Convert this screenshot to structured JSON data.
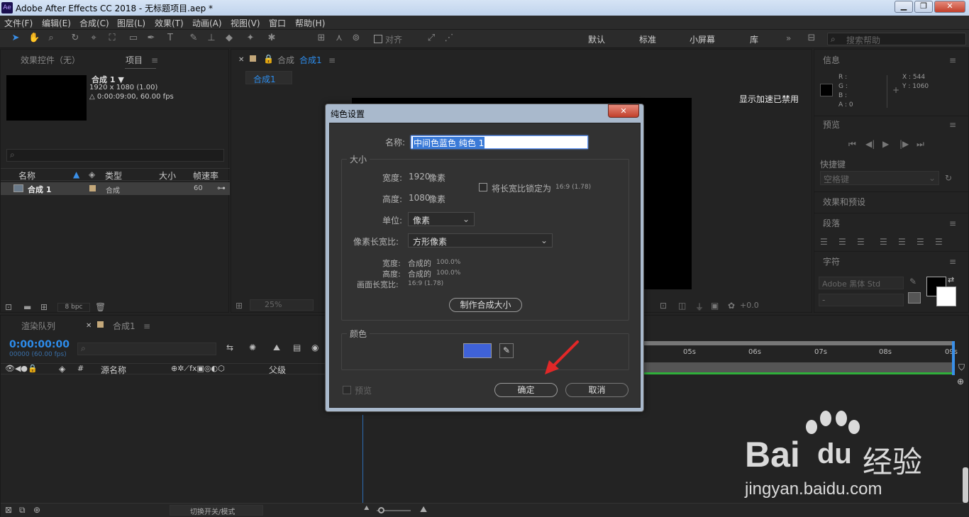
{
  "window": {
    "title": "Adobe After Effects CC 2018 - 无标题项目.aep *",
    "app_badge": "Ae",
    "min": "▁",
    "max": "❐",
    "close": "✕"
  },
  "menu": [
    "文件(F)",
    "编辑(E)",
    "合成(C)",
    "图层(L)",
    "效果(T)",
    "动画(A)",
    "视图(V)",
    "窗口",
    "帮助(H)"
  ],
  "toolbar": {
    "align_label": "对齐",
    "workspaces": [
      "默认",
      "标准",
      "小屏幕",
      "库"
    ],
    "more": "»",
    "search_placeholder": "搜索帮助"
  },
  "project_panel": {
    "tab_effects": "效果控件（无）",
    "tab_project": "项目",
    "comp_name": "合成 1 ▼",
    "comp_res": "1920 x 1080 (1.00)",
    "comp_dur": "△ 0:00:09:00, 60.00 fps",
    "columns": [
      "名称",
      "类型",
      "大小",
      "帧速率"
    ],
    "row": {
      "name": "合成 1",
      "type": "合成",
      "fps": "60"
    },
    "bpc": "8 bpc"
  },
  "comp_panel": {
    "tab_label": "合成",
    "tab_name": "合成1",
    "subtab": "合成1",
    "gpu_notice": "显示加速已禁用",
    "zoom": "25%",
    "exposure": "+0.0"
  },
  "right_panels": {
    "info": "信息",
    "info_r": "R :",
    "info_g": "G :",
    "info_b": "B :",
    "info_a": "A : 0",
    "info_x": "X : 544",
    "info_y": "Y : 1060",
    "preview": "预览",
    "shortcut": "快捷键",
    "shortcut_value": "空格键",
    "effects": "效果和预设",
    "paragraph": "段落",
    "character": "字符",
    "font": "Adobe 黑体 Std",
    "font_style": "-"
  },
  "timeline": {
    "tab_render": "渲染队列",
    "tab_comp": "合成1",
    "timecode": "0:00:00:00",
    "frames": "00000 (60.00 fps)",
    "col_source": "源名称",
    "col_parent": "父级",
    "col_hash": "#",
    "ticks": [
      "05s",
      "06s",
      "07s",
      "08s",
      "09s"
    ],
    "footer": "切换开关/模式"
  },
  "dialog": {
    "title": "纯色设置",
    "name_label": "名称:",
    "name_value": "中间色蓝色 纯色 1",
    "size_group": "大小",
    "width_label": "宽度:",
    "width_value": "1920",
    "width_unit": "像素",
    "height_label": "高度:",
    "height_value": "1080",
    "height_unit": "像素",
    "lock_label": "将长宽比锁定为",
    "lock_ratio": "16:9 (1.78)",
    "unit_label": "单位:",
    "unit_value": "像素",
    "par_label": "像素长宽比:",
    "par_value": "方形像素",
    "w_info_label": "宽度:",
    "w_info_value": "合成的",
    "w_info_pct": "100.0%",
    "h_info_label": "高度:",
    "h_info_value": "合成的",
    "h_info_pct": "100.0%",
    "frame_label": "画面长宽比:",
    "frame_value": "16:9 (1.78)",
    "make_comp_size": "制作合成大小",
    "color_group": "颜色",
    "color_hex": "#3f62d8",
    "preview_label": "预览",
    "ok": "确定",
    "cancel": "取消"
  },
  "watermark": {
    "brand": "Bai",
    "brand2": "du",
    "sub": "经验",
    "url": "jingyan.baidu.com"
  }
}
